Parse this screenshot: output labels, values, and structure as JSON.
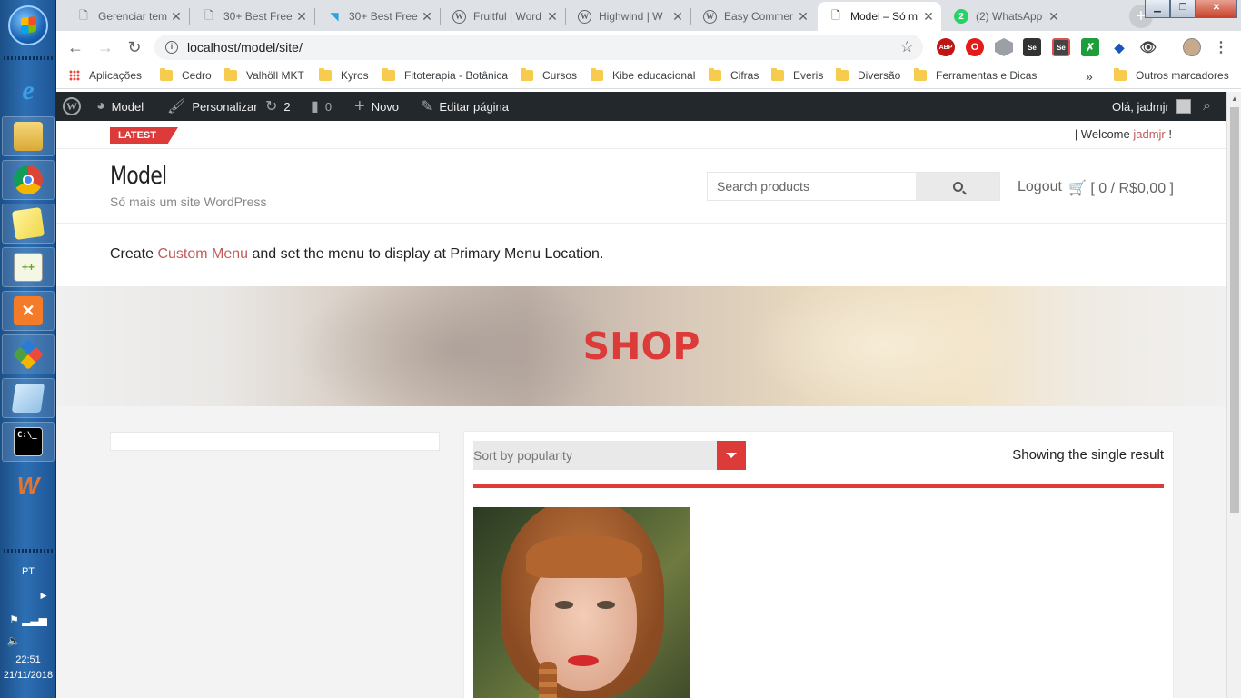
{
  "taskbar": {
    "language": "PT",
    "time": "22:51",
    "date": "21/11/2018",
    "items": [
      {
        "icon": "internet-explorer-icon"
      },
      {
        "icon": "file-explorer-icon"
      },
      {
        "icon": "chrome-icon"
      },
      {
        "icon": "sticky-notes-icon"
      },
      {
        "icon": "notepad-plus-plus-icon"
      },
      {
        "icon": "xampp-icon"
      },
      {
        "icon": "git-icon"
      },
      {
        "icon": "notepad-icon"
      },
      {
        "icon": "command-prompt-icon"
      },
      {
        "icon": "winamp-icon"
      }
    ]
  },
  "browser": {
    "tabs": [
      {
        "title": "Gerenciar tem",
        "icon": "page-icon"
      },
      {
        "title": "30+ Best Free",
        "icon": "page-icon"
      },
      {
        "title": "30+ Best Free",
        "icon": "arrow-icon"
      },
      {
        "title": "Fruitful | Word",
        "icon": "wordpress-icon"
      },
      {
        "title": "Highwind | W",
        "icon": "wordpress-icon"
      },
      {
        "title": "Easy Commer",
        "icon": "wordpress-icon"
      },
      {
        "title": "Model – Só m",
        "icon": "page-icon",
        "active": true
      },
      {
        "title": "(2) WhatsApp",
        "icon": "whatsapp-icon",
        "badge": "2"
      }
    ],
    "url": "localhost/model/site/",
    "extensions": [
      "ABP",
      "O",
      "",
      "Se",
      "Se",
      "",
      "",
      "",
      ""
    ],
    "bookmarks": {
      "apps": "Aplicações",
      "folders": [
        "Cedro",
        "Valhöll MKT",
        "Kyros",
        "Fitoterapia - Botânica",
        "Cursos",
        "Kibe educacional",
        "Cifras",
        "Everis",
        "Diversão",
        "Ferramentas e Dicas"
      ],
      "more": "»",
      "other": "Outros marcadores"
    }
  },
  "adminbar": {
    "site": "Model",
    "customize": "Personalizar",
    "updates": "2",
    "comments": "0",
    "new": "Novo",
    "edit": "Editar página",
    "greeting": "Olá, jadmjr"
  },
  "site": {
    "latest": "LATEST",
    "welcome_prefix": "| Welcome ",
    "welcome_user": "jadmjr",
    "welcome_suffix": " !",
    "title": "Model",
    "tagline": "Só mais um site WordPress",
    "search_placeholder": "Search products",
    "logout": "Logout",
    "cart": "[ 0 / R$0,00 ]",
    "menu_note_before": "Create ",
    "menu_note_link": "Custom Menu",
    "menu_note_after": " and set the menu to display at Primary Menu Location.",
    "banner_title": "SHOP",
    "sort_value": "Sort by popularity",
    "result_count": "Showing the single result"
  },
  "colors": {
    "accent": "#dd3a3a",
    "link": "#c05c5c",
    "adminbar": "#23282d"
  }
}
